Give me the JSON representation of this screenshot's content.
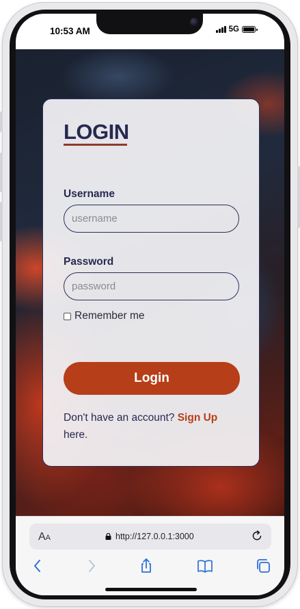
{
  "status_bar": {
    "time": "10:53 AM",
    "network": "5G"
  },
  "login_card": {
    "title": "LOGIN",
    "username_label": "Username",
    "username_placeholder": "username",
    "password_label": "Password",
    "password_placeholder": "password",
    "remember_label": "Remember me",
    "remember_checked": false,
    "login_button_label": "Login",
    "signup_prompt": "Don't have an account?",
    "signup_link": "Sign Up",
    "signup_suffix": "here."
  },
  "browser": {
    "text_size_label": "AA",
    "url": "http://127.0.0.1:3000",
    "toolbar_icons": [
      "back-icon",
      "forward-icon",
      "share-icon",
      "bookmarks-icon",
      "tabs-icon"
    ]
  },
  "colors": {
    "accent": "#b63e18",
    "card_text": "#27294f",
    "title_underline": "#8f3a2a"
  }
}
